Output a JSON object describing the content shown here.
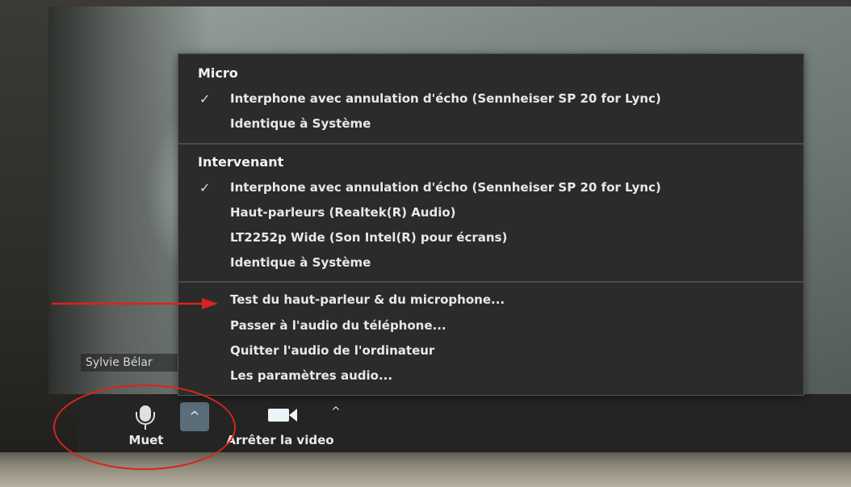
{
  "participant": {
    "name": "Sylvie Bélar"
  },
  "menu": {
    "micro": {
      "title": "Micro",
      "items": [
        {
          "label": "Interphone avec annulation d'écho (Sennheiser SP 20 for Lync)",
          "checked": true
        },
        {
          "label": "Identique à Système",
          "checked": false
        }
      ]
    },
    "intervenant": {
      "title": "Intervenant",
      "items": [
        {
          "label": "Interphone avec annulation d'écho (Sennheiser SP 20 for Lync)",
          "checked": true
        },
        {
          "label": "Haut-parleurs (Realtek(R) Audio)",
          "checked": false
        },
        {
          "label": "LT2252p Wide (Son Intel(R) pour écrans)",
          "checked": false
        },
        {
          "label": "Identique à Système",
          "checked": false
        }
      ]
    },
    "actions": [
      {
        "label": "Test du haut-parleur & du microphone..."
      },
      {
        "label": "Passer à l'audio du téléphone..."
      },
      {
        "label": "Quitter l'audio de l'ordinateur"
      },
      {
        "label": "Les paramètres audio..."
      }
    ],
    "check_glyph": "✓"
  },
  "toolbar": {
    "mute_label": "Muet",
    "stop_video_label": "Arrêter la video",
    "caret_glyph": "^"
  },
  "icons": {
    "mute": "microphone-icon",
    "video": "video-camera-icon",
    "caret": "chevron-up-icon"
  },
  "colors": {
    "annotation": "#d8241c",
    "menu_bg": "#2b2b2b",
    "caret_active_bg": "#5a6d78"
  }
}
